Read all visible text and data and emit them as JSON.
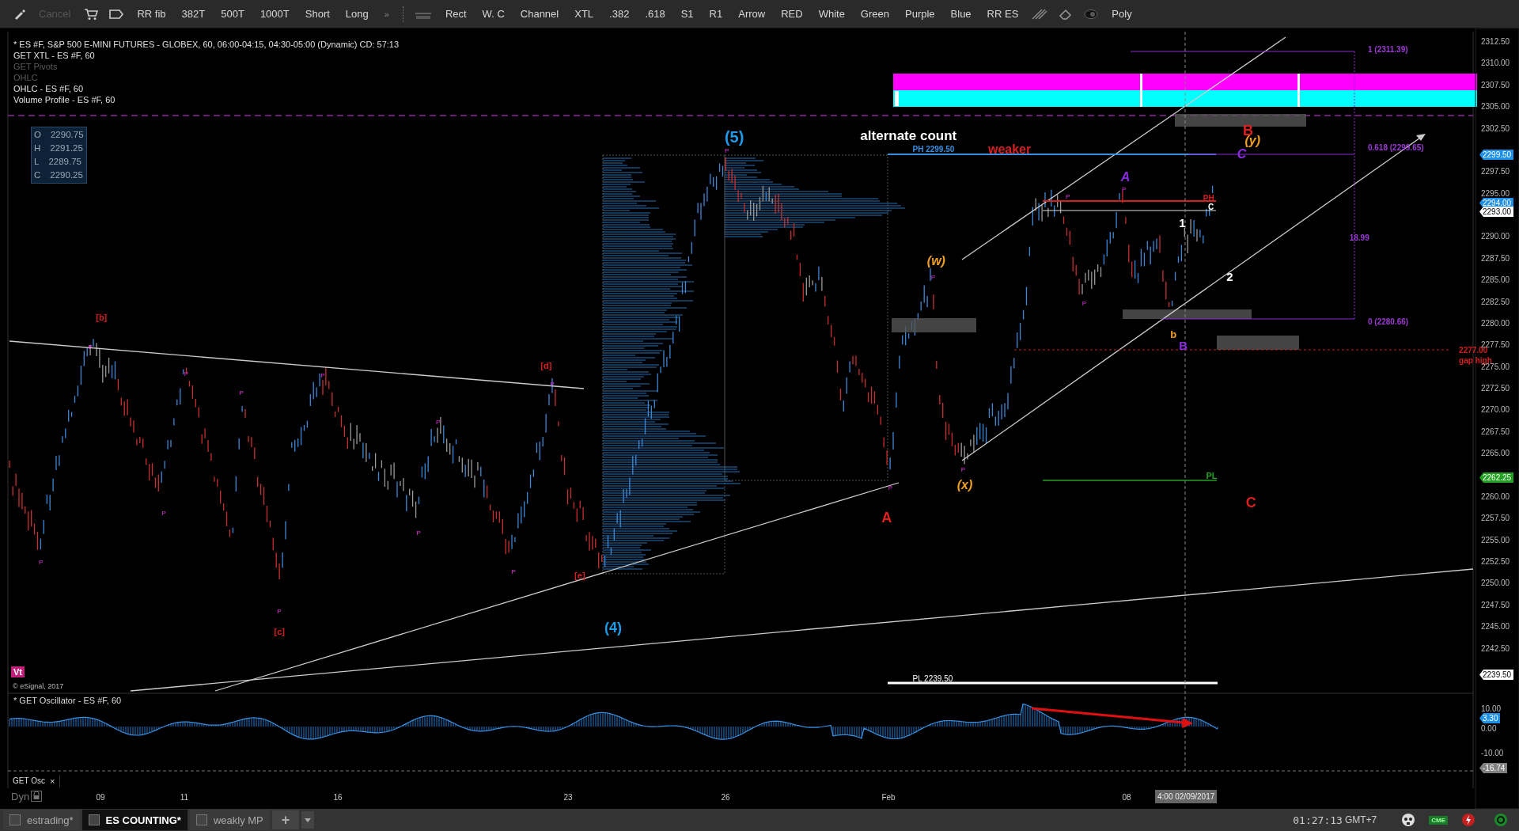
{
  "toolbar": {
    "cancel": {
      "label": "Cancel",
      "disabled": true
    },
    "group_1": [
      "RR fib",
      "382T",
      "500T",
      "1000T",
      "Short",
      "Long"
    ],
    "more": "»",
    "group_2": [
      "Rect",
      "W. C",
      "Channel",
      "XTL",
      ".382",
      ".618",
      "S1",
      "R1",
      "Arrow",
      "RED",
      "White",
      "Green",
      "Purple",
      "Blue",
      "RR ES"
    ],
    "last": "Poly"
  },
  "legend": [
    {
      "text": "* ES #F, S&P 500 E-MINI FUTURES - GLOBEX, 60, 06:00-04:15, 04:30-05:00 (Dynamic) CD: 57:13",
      "dimmed": false
    },
    {
      "text": "GET XTL - ES #F, 60",
      "dimmed": false
    },
    {
      "text": "GET Pivots",
      "dimmed": true
    },
    {
      "text": "OHLC",
      "dimmed": true
    },
    {
      "text": "OHLC - ES #F, 60",
      "dimmed": false
    },
    {
      "text": "Volume Profile - ES #F, 60",
      "dimmed": false
    }
  ],
  "ohlc": [
    {
      "label": "O",
      "value": "2290.75"
    },
    {
      "label": "H",
      "value": "2291.25"
    },
    {
      "label": "L",
      "value": "2289.75"
    },
    {
      "label": "C",
      "value": "2290.25"
    }
  ],
  "annotations": [
    {
      "text": "(5)",
      "color": "#1e9be8"
    },
    {
      "text": "alternate count",
      "color": "#ffffff"
    },
    {
      "text": "PH 2299.50",
      "color": "#3a8fe0"
    },
    {
      "text": "weaker",
      "color": "#d42020"
    },
    {
      "text": "A",
      "color": "#8a2be2"
    },
    {
      "text": "(w)",
      "color": "#f0a020"
    },
    {
      "text": "(x)",
      "color": "#f0a020"
    },
    {
      "text": "A",
      "color": "#e02020"
    },
    {
      "text": "(4)",
      "color": "#1e9be8"
    },
    {
      "text": "[b]",
      "color": "#d42020"
    },
    {
      "text": "[d]",
      "color": "#d42020"
    },
    {
      "text": "[e]",
      "color": "#d42020"
    },
    {
      "text": "[c]",
      "color": "#d42020"
    },
    {
      "text": "B",
      "color": "#e02020"
    },
    {
      "text": "(y)",
      "color": "#f0a020"
    },
    {
      "text": "C",
      "color": "#8a2be2"
    },
    {
      "text": "1",
      "color": "#ffffff"
    },
    {
      "text": "2",
      "color": "#ffffff"
    },
    {
      "text": "b",
      "color": "#f0a020"
    },
    {
      "text": "B",
      "color": "#8a2be2"
    },
    {
      "text": "C",
      "color": "#e02020"
    },
    {
      "text": "PL",
      "color": "#22a022"
    },
    {
      "text": "PL 2239.50",
      "color": "#ffffff"
    },
    {
      "text": "1 (2311.39)",
      "color": "#9a3ad0"
    },
    {
      "text": "0.618 (2299.65)",
      "color": "#9a3ad0"
    },
    {
      "text": "18.99",
      "color": "#9a3ad0"
    },
    {
      "text": "0 (2280.66)",
      "color": "#9a3ad0"
    },
    {
      "text": "2277.00",
      "color": "#d42020"
    },
    {
      "text": "gap high",
      "color": "#d42020"
    },
    {
      "text": "PH",
      "color": "#d42020"
    },
    {
      "text": "C",
      "color": "#ffffff"
    }
  ],
  "pivots": [
    "P",
    "P",
    "P",
    "P",
    "P",
    "P",
    "P",
    "P",
    "P",
    "P",
    "P",
    "P",
    "P",
    "P",
    "P",
    "P",
    "P",
    "P"
  ],
  "watermark_note": "© eSignal, 2017",
  "badge": "Vt",
  "price_axis": [
    "2312.50",
    "2310.00",
    "2307.50",
    "2305.00",
    "2302.50",
    "2297.50",
    "2295.00",
    "2290.00",
    "2287.50",
    "2285.00",
    "2282.50",
    "2280.00",
    "2277.50",
    "2275.00",
    "2272.50",
    "2270.00",
    "2267.50",
    "2265.00",
    "2260.00",
    "2257.50",
    "2255.00",
    "2252.50",
    "2250.00",
    "2247.50",
    "2245.00",
    "2242.50"
  ],
  "price_tags": [
    {
      "text": "2299.50",
      "color": "#1e90e8"
    },
    {
      "text": "2294.00",
      "color": "#1e90e8"
    },
    {
      "text": "2293.00",
      "color": "#ffffff"
    },
    {
      "text": "2262.25",
      "color": "#22a022"
    },
    {
      "text": "2239.50",
      "color": "#ffffff"
    }
  ],
  "oscillator": {
    "title": "* GET Oscillator - ES #F, 60",
    "axis": [
      "10.00",
      "0.00",
      "-10.00"
    ],
    "tags": [
      {
        "text": "3.30",
        "color": "#1e90e8"
      },
      {
        "text": "-16.74",
        "color": "#808080"
      }
    ],
    "tab": "GET Osc",
    "close": "×"
  },
  "time_axis": {
    "mode": "Dyn",
    "labels": [
      "09",
      "11",
      "16",
      "23",
      "26",
      "Feb",
      "08"
    ],
    "cursor": "4:00 02/09/2017"
  },
  "page_tabs": [
    {
      "label": "estrading*",
      "selected": false
    },
    {
      "label": "ES COUNTING*",
      "selected": true
    },
    {
      "label": "weakly MP",
      "selected": false
    }
  ],
  "add_tab": "+",
  "status": {
    "time": "01:27:13",
    "zone": "GMT+7",
    "feed": "CME"
  }
}
